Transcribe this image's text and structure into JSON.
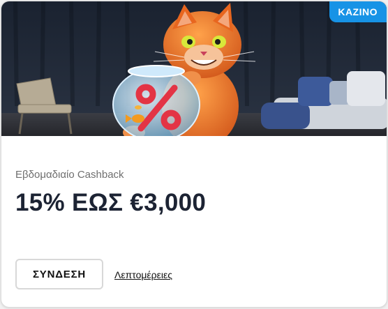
{
  "badge": {
    "label": "KAZINO",
    "color": "#1793e6"
  },
  "banner": {
    "image": "orange-cat-with-percent-fishbowl"
  },
  "promo": {
    "subtitle": "Εβδομαδιαίο Cashback",
    "headline": "15% ΕΩΣ €3,000"
  },
  "actions": {
    "login_label": "ΣΥΝΔΕΣΗ",
    "details_label": "Λεπτομέρειες"
  }
}
